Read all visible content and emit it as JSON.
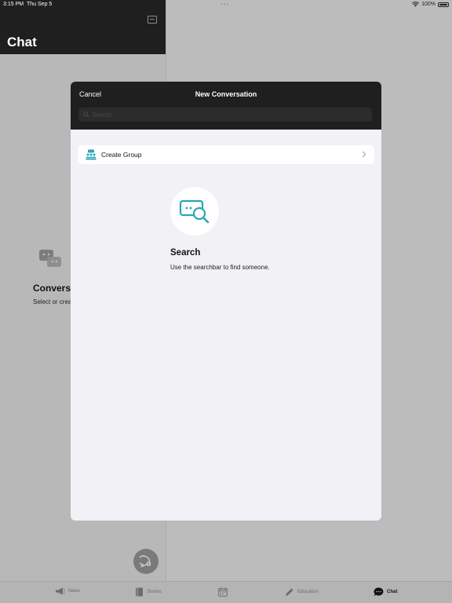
{
  "status_bar": {
    "time": "3:15 PM",
    "date": "Thu Sep 5",
    "battery": "100%"
  },
  "sidebar": {
    "title": "Chat"
  },
  "empty_state": {
    "title": "Conversations",
    "subtitle": "Select or create a conversation"
  },
  "modal": {
    "cancel_label": "Cancel",
    "title": "New Conversation",
    "search_placeholder": "Search",
    "create_group_label": "Create Group",
    "search_heading": "Search",
    "search_description": "Use the searchbar to find someone."
  },
  "tabs": [
    {
      "label": "News",
      "icon": "megaphone-icon"
    },
    {
      "label": "Stories",
      "icon": "book-icon"
    },
    {
      "label": "",
      "icon": "calendar-icon"
    },
    {
      "label": "Education",
      "icon": "pencil-icon"
    },
    {
      "label": "Chat",
      "icon": "chat-bubble-icon",
      "active": true
    }
  ],
  "colors": {
    "accent": "#2aa6b6",
    "header": "#1f1f1f",
    "modal_bg": "#f1f1f6"
  }
}
